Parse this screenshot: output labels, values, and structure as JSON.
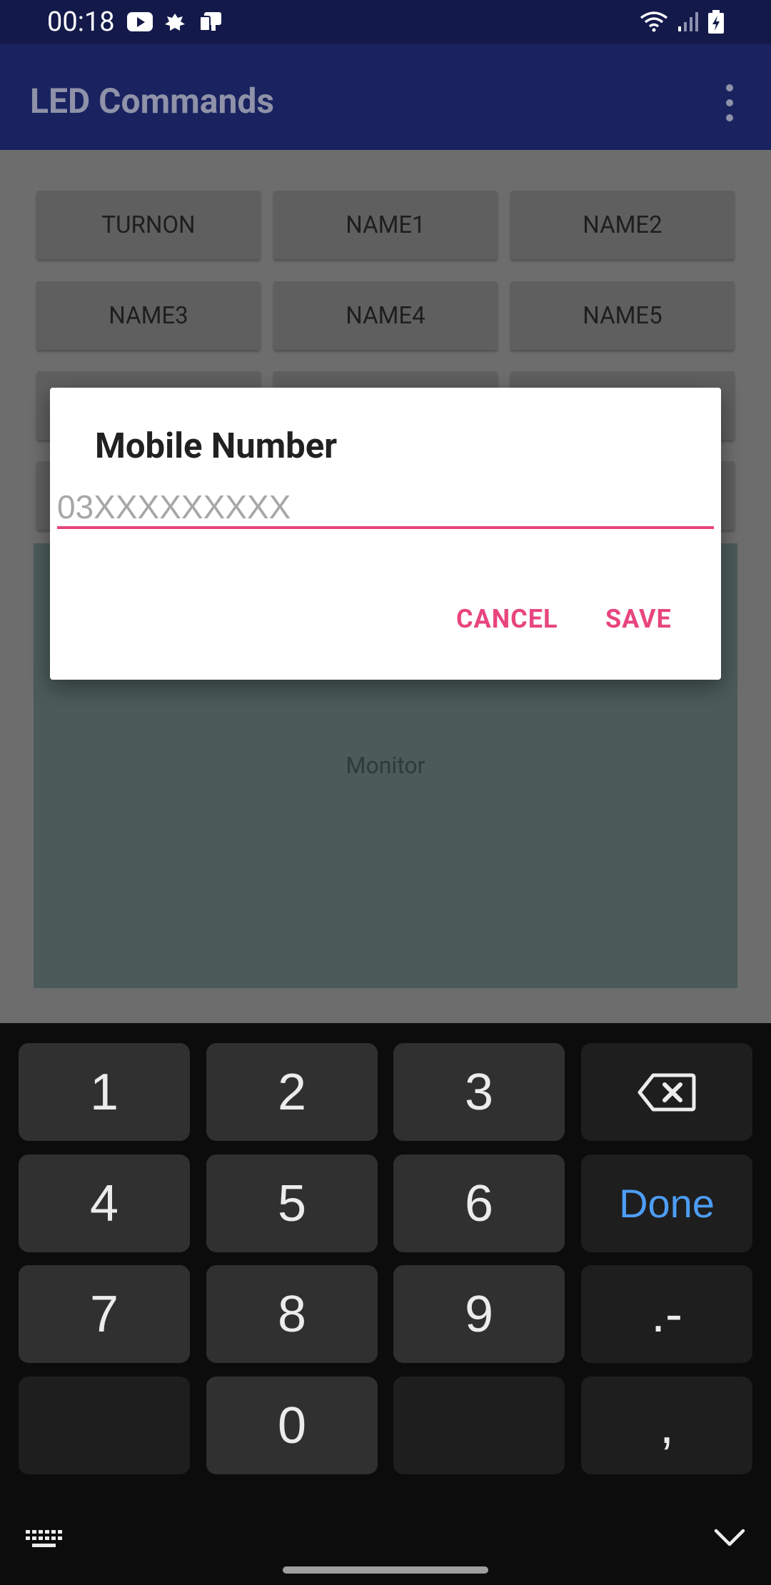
{
  "status_bar": {
    "time": "00:18",
    "icons": [
      "youtube-icon",
      "notification-icon",
      "app-icon",
      "wifi-icon",
      "signal-icon",
      "battery-charging-icon"
    ]
  },
  "app_bar": {
    "title": "LED Commands",
    "menu_icon": "more-vert-icon"
  },
  "command_buttons": [
    {
      "label": "TURNON"
    },
    {
      "label": "NAME1"
    },
    {
      "label": "NAME2"
    },
    {
      "label": "NAME3"
    },
    {
      "label": "NAME4"
    },
    {
      "label": "NAME5"
    }
  ],
  "monitor": {
    "label": "Monitor"
  },
  "dialog": {
    "title": "Mobile Number",
    "input_value": "",
    "input_placeholder": "03XXXXXXXXX",
    "cancel_label": "CANCEL",
    "save_label": "SAVE"
  },
  "keyboard": {
    "keys": [
      "1",
      "2",
      "3",
      "4",
      "5",
      "6",
      "7",
      "8",
      "9",
      "0"
    ],
    "done_label": "Done",
    "symbols_label": ".-",
    "comma_label": ","
  },
  "colors": {
    "accent": "#e8457f",
    "primary": "#1a2360",
    "done_blue": "#4d9df5"
  }
}
